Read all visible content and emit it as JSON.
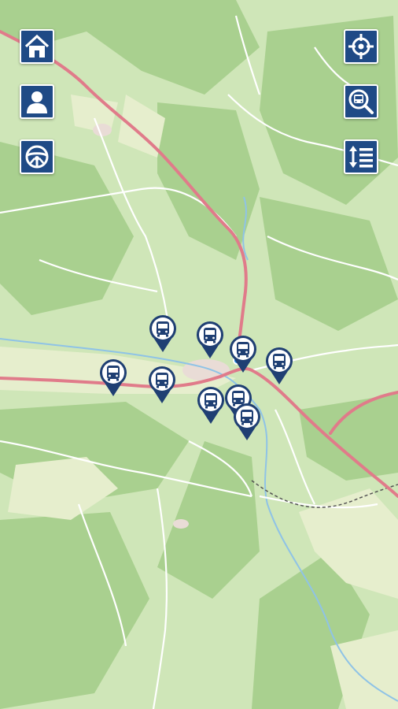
{
  "map": {
    "current_location": "current-location-dot",
    "colors": {
      "land": "#cfe6b8",
      "forest": "#a7cf8d",
      "meadow": "#e9efd2",
      "main_road": "#e07b8a",
      "secondary_road": "#ffffff",
      "river": "#8fc3e6",
      "railway": "#555555",
      "control_bg": "#1f4a86",
      "pin_bg": "#1f3f73"
    }
  },
  "controls": {
    "left": [
      {
        "icon": "home-icon",
        "name": "home-button"
      },
      {
        "icon": "user-icon",
        "name": "profile-button"
      },
      {
        "icon": "steering-wheel-icon",
        "name": "driver-button"
      }
    ],
    "right": [
      {
        "icon": "crosshair-icon",
        "name": "locate-button"
      },
      {
        "icon": "bus-search-icon",
        "name": "search-bus-button"
      },
      {
        "icon": "list-sort-icon",
        "name": "list-button"
      }
    ]
  },
  "bus_markers": [
    {
      "icon": "bus-icon"
    },
    {
      "icon": "bus-icon"
    },
    {
      "icon": "bus-icon"
    },
    {
      "icon": "bus-icon"
    },
    {
      "icon": "bus-icon"
    },
    {
      "icon": "bus-icon"
    },
    {
      "icon": "bus-icon"
    },
    {
      "icon": "bus-icon"
    },
    {
      "icon": "bus-icon"
    }
  ]
}
